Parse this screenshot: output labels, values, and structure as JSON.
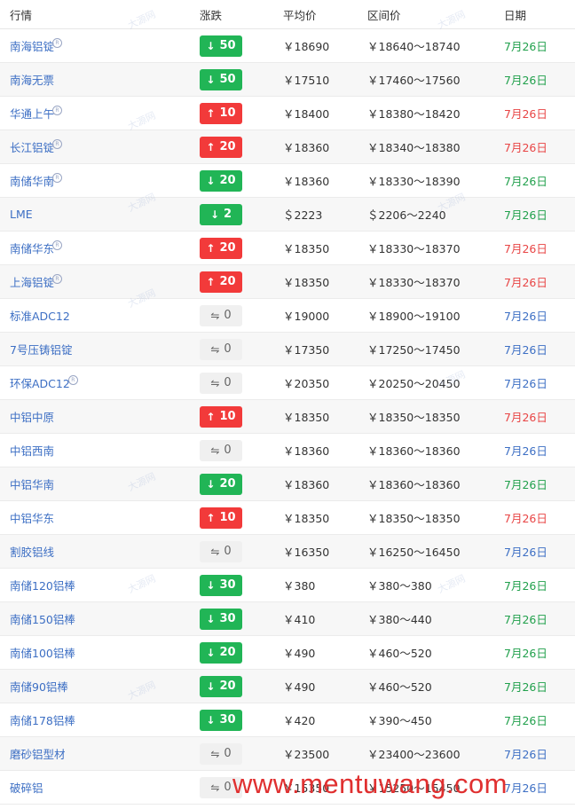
{
  "header": {
    "col_name": "行情",
    "col_change": "涨跌",
    "col_avg": "平均价",
    "col_range": "区间价",
    "col_date": "日期"
  },
  "colors": {
    "up": "#f23a3a",
    "down": "#21b556",
    "flat": "#f0f0f0",
    "link": "#3d6fc4"
  },
  "rows": [
    {
      "name": "南海铝锭",
      "reg": true,
      "dir": "down",
      "arrow": "↓",
      "change": "50",
      "avg": "￥18690",
      "range": "￥18640～18740",
      "date": "7月26日",
      "date_color": "green"
    },
    {
      "name": "南海无票",
      "reg": false,
      "dir": "down",
      "arrow": "↓",
      "change": "50",
      "avg": "￥17510",
      "range": "￥17460～17560",
      "date": "7月26日",
      "date_color": "green"
    },
    {
      "name": "华通上午",
      "reg": true,
      "dir": "up",
      "arrow": "↑",
      "change": "10",
      "avg": "￥18400",
      "range": "￥18380～18420",
      "date": "7月26日",
      "date_color": "red"
    },
    {
      "name": "长江铝锭",
      "reg": true,
      "dir": "up",
      "arrow": "↑",
      "change": "20",
      "avg": "￥18360",
      "range": "￥18340～18380",
      "date": "7月26日",
      "date_color": "red"
    },
    {
      "name": "南储华南",
      "reg": true,
      "dir": "down",
      "arrow": "↓",
      "change": "20",
      "avg": "￥18360",
      "range": "￥18330～18390",
      "date": "7月26日",
      "date_color": "green"
    },
    {
      "name": "LME",
      "reg": false,
      "dir": "down",
      "arrow": "↓",
      "change": "2",
      "avg": "＄2223",
      "range": "＄2206～2240",
      "date": "7月26日",
      "date_color": "green"
    },
    {
      "name": "南储华东",
      "reg": true,
      "dir": "up",
      "arrow": "↑",
      "change": "20",
      "avg": "￥18350",
      "range": "￥18330～18370",
      "date": "7月26日",
      "date_color": "red"
    },
    {
      "name": "上海铝锭",
      "reg": true,
      "dir": "up",
      "arrow": "↑",
      "change": "20",
      "avg": "￥18350",
      "range": "￥18330～18370",
      "date": "7月26日",
      "date_color": "red"
    },
    {
      "name": "标准ADC12",
      "reg": false,
      "dir": "flat",
      "arrow": "⇋",
      "change": "0",
      "avg": "￥19000",
      "range": "￥18900～19100",
      "date": "7月26日",
      "date_color": "blue"
    },
    {
      "name": "7号压铸铝锭",
      "reg": false,
      "dir": "flat",
      "arrow": "⇋",
      "change": "0",
      "avg": "￥17350",
      "range": "￥17250～17450",
      "date": "7月26日",
      "date_color": "blue"
    },
    {
      "name": "环保ADC12",
      "reg": true,
      "dir": "flat",
      "arrow": "⇋",
      "change": "0",
      "avg": "￥20350",
      "range": "￥20250～20450",
      "date": "7月26日",
      "date_color": "blue"
    },
    {
      "name": "中铝中原",
      "reg": false,
      "dir": "up",
      "arrow": "↑",
      "change": "10",
      "avg": "￥18350",
      "range": "￥18350～18350",
      "date": "7月26日",
      "date_color": "red"
    },
    {
      "name": "中铝西南",
      "reg": false,
      "dir": "flat",
      "arrow": "⇋",
      "change": "0",
      "avg": "￥18360",
      "range": "￥18360～18360",
      "date": "7月26日",
      "date_color": "blue"
    },
    {
      "name": "中铝华南",
      "reg": false,
      "dir": "down",
      "arrow": "↓",
      "change": "20",
      "avg": "￥18360",
      "range": "￥18360～18360",
      "date": "7月26日",
      "date_color": "green"
    },
    {
      "name": "中铝华东",
      "reg": false,
      "dir": "up",
      "arrow": "↑",
      "change": "10",
      "avg": "￥18350",
      "range": "￥18350～18350",
      "date": "7月26日",
      "date_color": "red"
    },
    {
      "name": "割胶铝线",
      "reg": false,
      "dir": "flat",
      "arrow": "⇋",
      "change": "0",
      "avg": "￥16350",
      "range": "￥16250～16450",
      "date": "7月26日",
      "date_color": "blue"
    },
    {
      "name": "南储120铝棒",
      "reg": false,
      "dir": "down",
      "arrow": "↓",
      "change": "30",
      "avg": "￥380",
      "range": "￥380～380",
      "date": "7月26日",
      "date_color": "green"
    },
    {
      "name": "南储150铝棒",
      "reg": false,
      "dir": "down",
      "arrow": "↓",
      "change": "30",
      "avg": "￥410",
      "range": "￥380～440",
      "date": "7月26日",
      "date_color": "green"
    },
    {
      "name": "南储100铝棒",
      "reg": false,
      "dir": "down",
      "arrow": "↓",
      "change": "20",
      "avg": "￥490",
      "range": "￥460～520",
      "date": "7月26日",
      "date_color": "green"
    },
    {
      "name": "南储90铝棒",
      "reg": false,
      "dir": "down",
      "arrow": "↓",
      "change": "20",
      "avg": "￥490",
      "range": "￥460～520",
      "date": "7月26日",
      "date_color": "green"
    },
    {
      "name": "南储178铝棒",
      "reg": false,
      "dir": "down",
      "arrow": "↓",
      "change": "30",
      "avg": "￥420",
      "range": "￥390～450",
      "date": "7月26日",
      "date_color": "green"
    },
    {
      "name": "磨砂铝型材",
      "reg": false,
      "dir": "flat",
      "arrow": "⇋",
      "change": "0",
      "avg": "￥23500",
      "range": "￥23400～23600",
      "date": "7月26日",
      "date_color": "blue"
    },
    {
      "name": "破碎铝",
      "reg": false,
      "dir": "flat",
      "arrow": "⇋",
      "change": "0",
      "avg": "￥15350",
      "range": "￥15250～15450",
      "date": "7月26日",
      "date_color": "blue"
    }
  ],
  "reg_mark": "R",
  "watermark": {
    "site": "www.mentuwang.com",
    "faint": "大源网"
  }
}
